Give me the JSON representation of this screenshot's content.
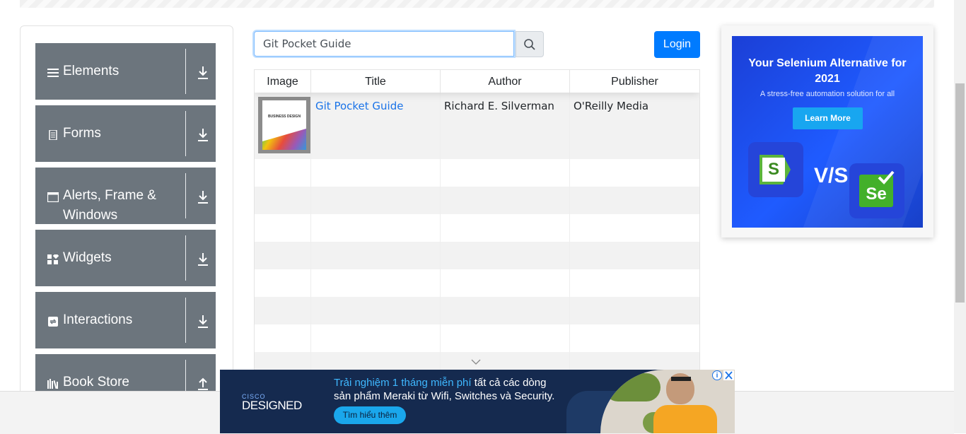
{
  "sidebar": {
    "groups": [
      {
        "label": "Elements",
        "icon": "bars-icon"
      },
      {
        "label": "Forms",
        "icon": "file-icon"
      },
      {
        "label": "Alerts, Frame & Windows",
        "icon": "window-icon"
      },
      {
        "label": "Widgets",
        "icon": "widgets-icon"
      },
      {
        "label": "Interactions",
        "icon": "sync-icon"
      },
      {
        "label": "Book Store",
        "icon": "books-icon"
      }
    ]
  },
  "search": {
    "value": "Git Pocket Guide",
    "icon": "search-icon"
  },
  "header": {
    "login_label": "Login"
  },
  "table": {
    "columns": [
      "Image",
      "Title",
      "Author",
      "Publisher"
    ],
    "rows": [
      {
        "title": "Git Pocket Guide",
        "author": "Richard E. Silverman",
        "publisher": "O'Reilly Media",
        "cover_text": "BUSINESS DESIGN"
      }
    ]
  },
  "ad_right": {
    "headline": "Your Selenium Alternative for 2021",
    "subline": "A stress-free automation solution for all",
    "cta": "Learn More",
    "vs": "V/S",
    "logo_left": "S",
    "logo_right": "Se"
  },
  "ad_bottom": {
    "brand_top": "CISCO",
    "brand": "DESIGNED",
    "line1_highlight": "Trải nghiệm 1 tháng miễn phí",
    "line1_rest": " tất cả các dòng",
    "line2": "sản phẩm Meraki từ Wifi, Switches và Security.",
    "cta": "Tìm hiểu thêm"
  },
  "colors": {
    "primary": "#007bff",
    "group_bg": "#6c757d",
    "ad_blue": "#1f5bff",
    "ad_navy": "#152a4f"
  }
}
